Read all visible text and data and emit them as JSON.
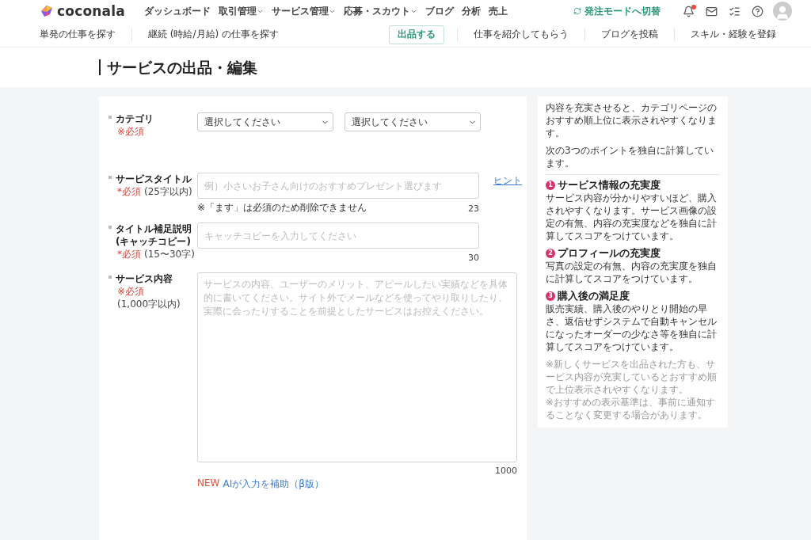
{
  "header": {
    "logo": "coconala",
    "nav": [
      {
        "label": "ダッシュボード",
        "kind": "link"
      },
      {
        "label": "取引管理",
        "kind": "dropdown"
      },
      {
        "label": "サービス管理",
        "kind": "dropdown"
      },
      {
        "label": "応募・スカウト",
        "kind": "dropdown"
      },
      {
        "label": "ブログ",
        "kind": "link"
      },
      {
        "label": "分析",
        "kind": "link"
      },
      {
        "label": "売上",
        "kind": "link"
      }
    ],
    "mode_switch": "発注モードへ切替",
    "notification_unread": true
  },
  "subnav": {
    "left": [
      "単発の仕事を探す",
      "継続 (時給/月給) の仕事を探す"
    ],
    "primary": "出品する",
    "right": [
      "仕事を紹介してもらう",
      "ブログを投稿",
      "スキル・経験を登録"
    ]
  },
  "page_title": "サービスの出品・編集",
  "form": {
    "fields": [
      {
        "kind": "select-pair",
        "label": [
          "カテゴリ"
        ],
        "required": "※必須",
        "selects": [
          "選択してください",
          "選択してください"
        ]
      },
      {
        "kind": "input",
        "label": [
          "サービスタイトル"
        ],
        "required": "*必須",
        "limit": "(25字以内)",
        "placeholder": "例）小さいお子さん向けのおすすめプレゼント選びます",
        "note": "※「ます」は必須のため削除できません",
        "count": "23",
        "hint": "ヒント"
      },
      {
        "kind": "input",
        "label": [
          "タイトル補足説明",
          "(キャッチコピー)"
        ],
        "required": "*必須",
        "limit": "(15〜30字)",
        "placeholder": "キャッチコピーを入力してください",
        "count": "30"
      },
      {
        "kind": "textarea",
        "label": [
          "サービス内容"
        ],
        "required": "※必須",
        "limit": "(1,000字以内)",
        "placeholder": "サービスの内容、ユーザーのメリット、アピールしたい実績などを具体的に書いてください。サイト外でメールなどを使ってやり取りしたり、実際に会ったりすることを前提としたサービスはお控えください。",
        "count": "1000"
      }
    ],
    "ai_badge": "NEW",
    "ai_link": "AIが入力を補助（β版）"
  },
  "sidebar": {
    "intro": [
      "内容を充実させると、カテゴリページのおすすめ順上位に表示されやすくなります。",
      "次の3つのポイントを独自に計算しています。"
    ],
    "points": [
      {
        "number": "1",
        "title": "サービス情報の充実度",
        "body": "サービス内容が分かりやすいほど、購入されやすくなります。サービス画像の設定の有無、内容の充実度などを独自に計算してスコアをつけています。"
      },
      {
        "number": "2",
        "title": "プロフィールの充実度",
        "body": "写真の設定の有無、内容の充実度を独自に計算してスコアをつけています。"
      },
      {
        "number": "3",
        "title": "購入後の満足度",
        "body": "販売実績、購入後のやりとり開始の早さ、返信せずシステムで自動キャンセルになったオーダーの少なさ等を独自に計算してスコアをつけています。"
      }
    ],
    "notes": [
      "※新しくサービスを出品された方も、サービス内容が充実しているとおすすめ順で上位表示されやすくなります。",
      "※おすすめの表示基準は、事前に通知することなく変更する場合があります。"
    ]
  }
}
